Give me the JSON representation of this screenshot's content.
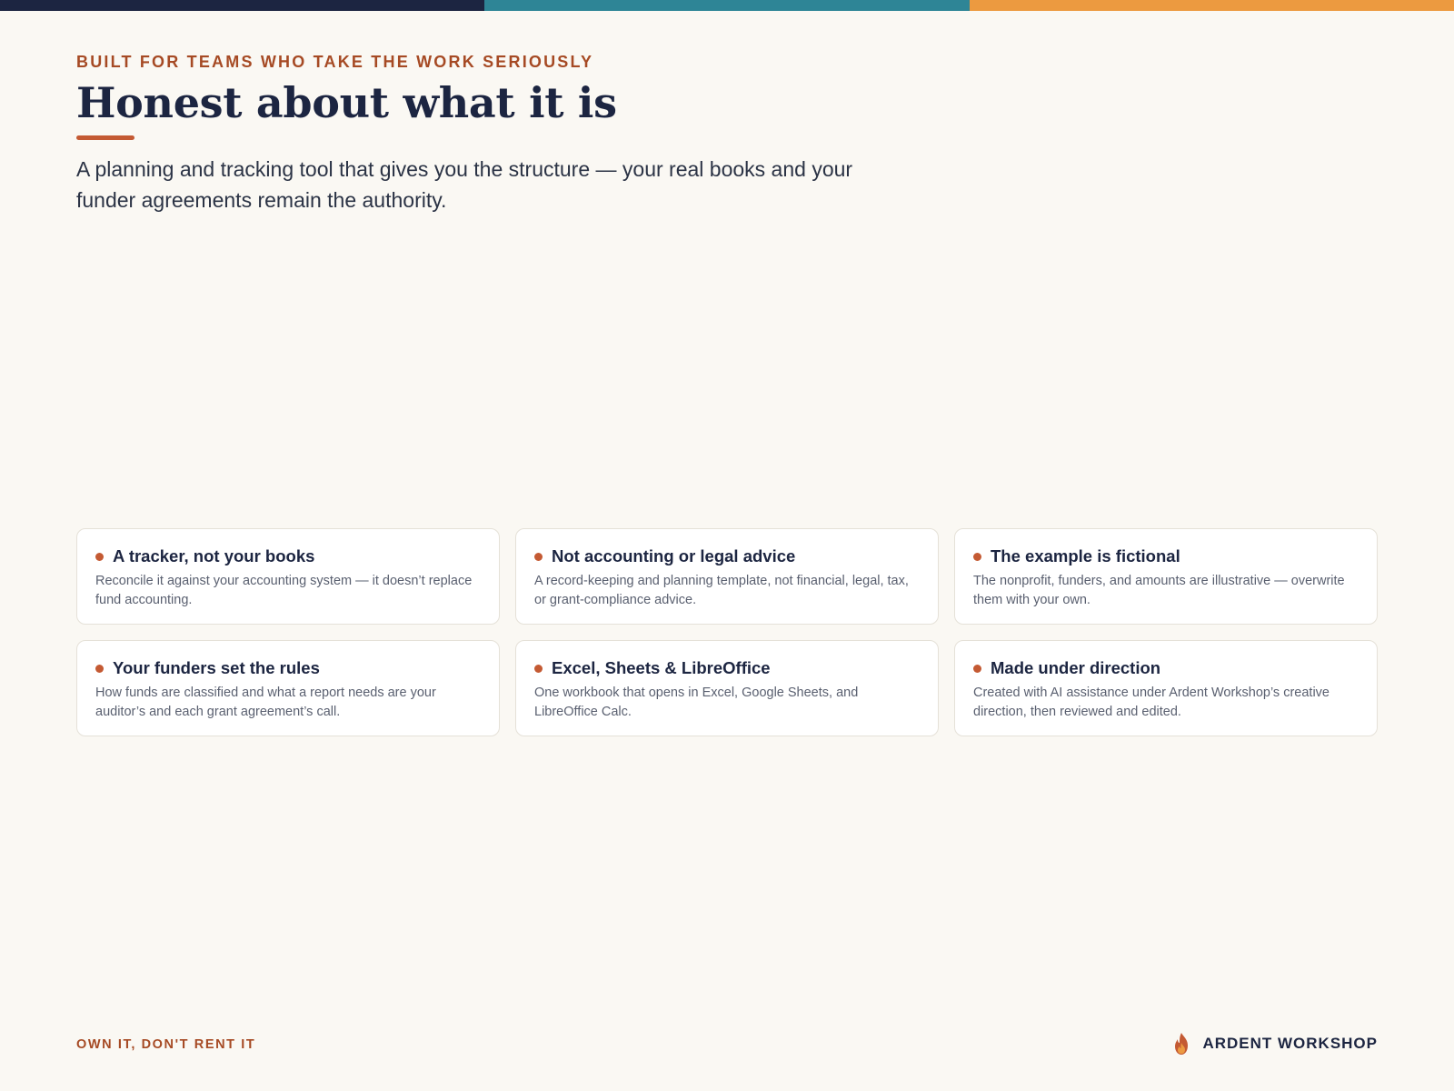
{
  "colors": {
    "navy": "#1c2541",
    "teal": "#2e8596",
    "orange": "#ec9a40",
    "accent": "#c45a33",
    "background": "#faf8f3"
  },
  "header": {
    "eyebrow": "BUILT FOR TEAMS WHO TAKE THE WORK SERIOUSLY",
    "title": "Honest about what it is",
    "lede": "A planning and tracking tool that gives you the structure — your real books and your funder agreements remain the authority."
  },
  "cards": [
    {
      "title": "A tracker, not your books",
      "description": "Reconcile it against your accounting system — it doesn’t replace fund accounting."
    },
    {
      "title": "Not accounting or legal advice",
      "description": "A record-keeping and planning template, not financial, legal, tax, or grant-compliance advice."
    },
    {
      "title": "The example is fictional",
      "description": "The nonprofit, funders, and amounts are illustrative — overwrite them with your own."
    },
    {
      "title": "Your funders set the rules",
      "description": "How funds are classified and what a report needs are your auditor’s and each grant agreement’s call."
    },
    {
      "title": "Excel, Sheets & LibreOffice",
      "description": "One workbook that opens in Excel, Google Sheets, and LibreOffice Calc."
    },
    {
      "title": "Made under direction",
      "description": "Created with AI assistance under Ardent Workshop’s creative direction, then reviewed and edited."
    }
  ],
  "footer": {
    "tagline": "OWN IT, DON'T RENT IT",
    "brand": "ARDENT WORKSHOP",
    "brand_icon": "flame-icon"
  }
}
